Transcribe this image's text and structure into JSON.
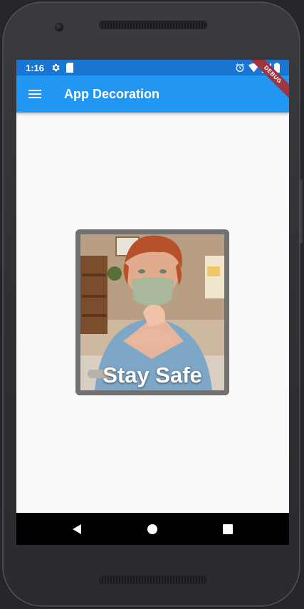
{
  "status_bar": {
    "time": "1:16",
    "icons": [
      "settings-icon",
      "sd-card-icon",
      "alarm-icon",
      "wifi-icon",
      "signal-icon",
      "battery-icon"
    ]
  },
  "app_bar": {
    "title": "App Decoration",
    "menu_icon": "hamburger-menu-icon",
    "debug_banner": "DEBUG",
    "color": "#2196f3"
  },
  "card": {
    "caption": "Stay Safe",
    "image": "child-wearing-mask-photo",
    "border_color": "#717171"
  },
  "nav_bar": {
    "buttons": [
      "back-icon",
      "home-icon",
      "recents-icon"
    ]
  }
}
